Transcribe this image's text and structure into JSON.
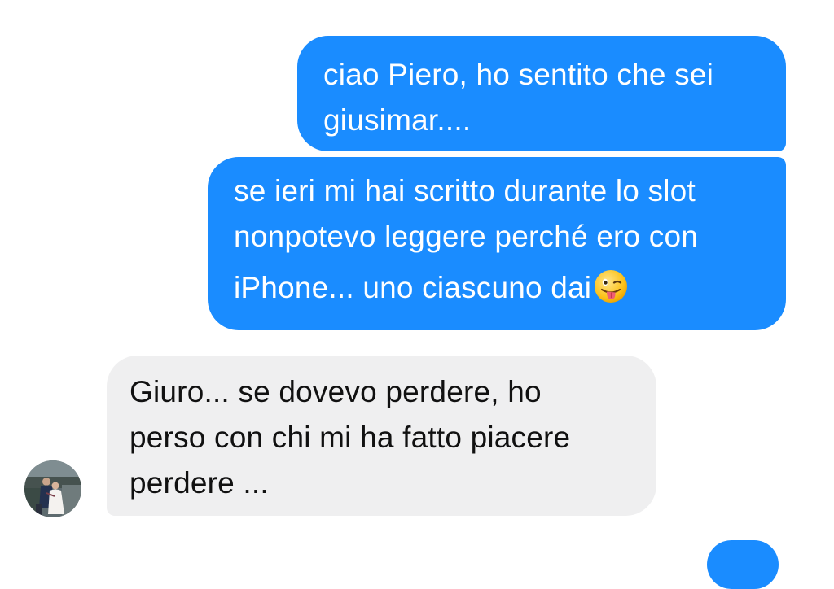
{
  "conversation": {
    "messages": [
      {
        "direction": "outgoing",
        "lines": [
          "ciao Piero, ho sentito che sei",
          "giusimar...."
        ]
      },
      {
        "direction": "outgoing",
        "lines": [
          "se ieri mi hai scritto durante lo slot",
          "nonpotevo leggere perché ero con",
          "iPhone... uno ciascuno dai"
        ],
        "emoji": "winking-face-with-tongue-emoji"
      },
      {
        "direction": "incoming",
        "lines": [
          "Giuro... se dovevo perdere, ho",
          "perso con chi mi ha fatto piacere",
          "perdere ..."
        ]
      }
    ]
  },
  "colors": {
    "outgoing_bubble": "#1a8cff",
    "incoming_bubble": "#efeff0",
    "outgoing_text": "#ffffff",
    "incoming_text": "#111111"
  }
}
